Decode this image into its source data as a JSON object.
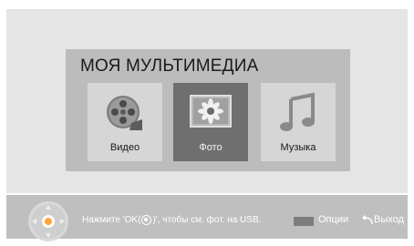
{
  "panel": {
    "title": "МОЯ МУЛЬТИМЕДИА",
    "tiles": [
      {
        "label": "Видео",
        "icon": "film-reel-icon"
      },
      {
        "label": "Фото",
        "icon": "photo-icon",
        "selected": true
      },
      {
        "label": "Музыка",
        "icon": "music-note-icon"
      }
    ]
  },
  "footer": {
    "hint_prefix": "Нажмите 'OK(",
    "hint_suffix": ")', чтобы см. фот. на USB.",
    "options_label": "Опции",
    "exit_label": "Выход"
  },
  "colors": {
    "background": "#e5e5e5",
    "panel": "#bcbcbc",
    "tile": "#d6d6d6",
    "tile_selected": "#6f6f6f",
    "footer": "#bfbfbf"
  }
}
